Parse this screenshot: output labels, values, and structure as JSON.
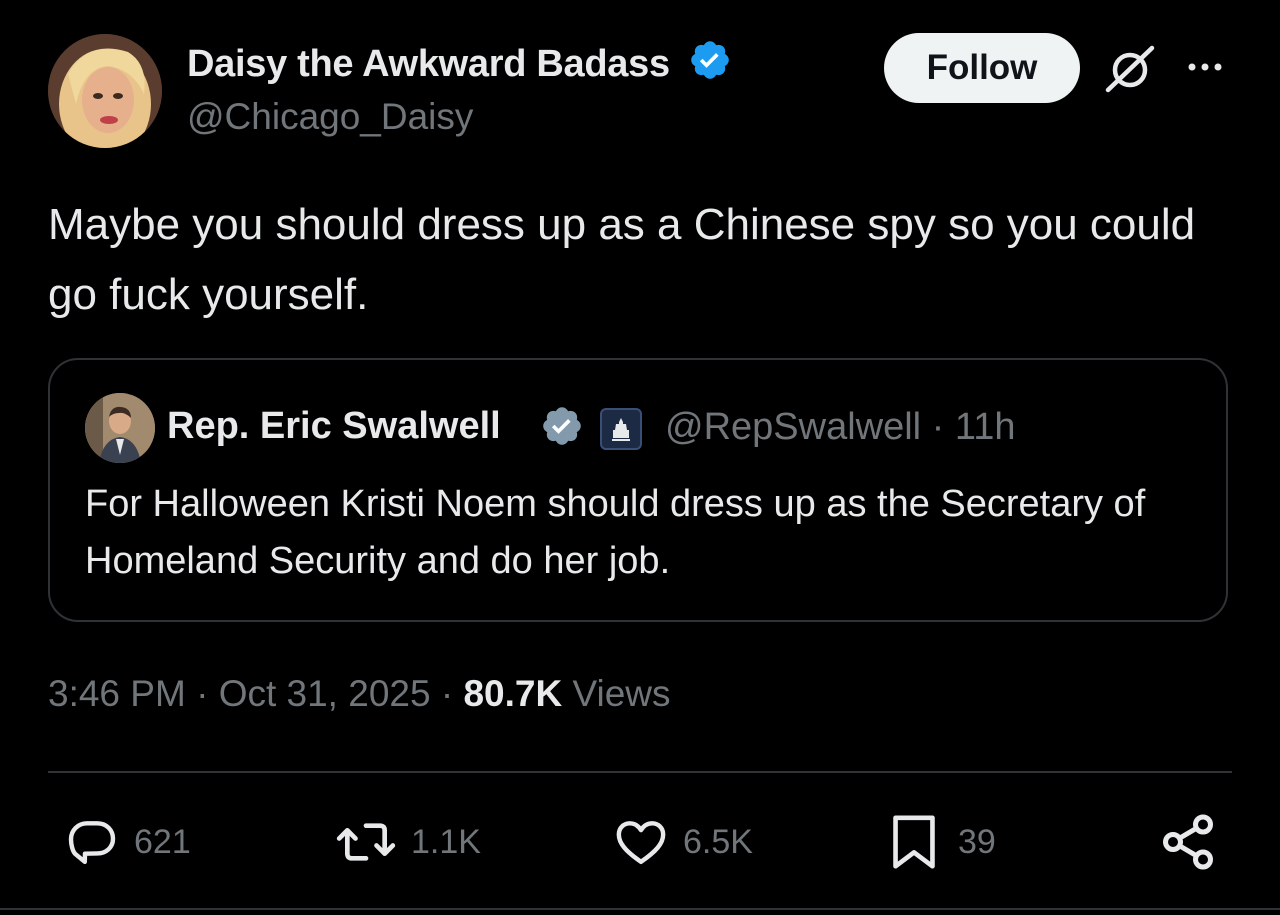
{
  "author": {
    "name": "Daisy the Awkward Badass",
    "handle": "@Chicago_Daisy",
    "verified_color": "#1d9bf0"
  },
  "header": {
    "follow_label": "Follow",
    "icons": [
      "grok-icon",
      "more-icon"
    ]
  },
  "tweet": {
    "text": "Maybe you should dress up as a Chinese spy so you could go fuck yourself."
  },
  "quote": {
    "name": "Rep. Eric Swalwell",
    "handle_time": "@RepSwalwell · 11h",
    "verified_color": "#829aab",
    "text": "For Halloween Kristi Noem should dress up as the Secretary of Homeland Security and do her job."
  },
  "meta": {
    "time": "3:46 PM",
    "date": "Oct 31, 2025",
    "views_count": "80.7K",
    "views_label": "Views",
    "sep": "·"
  },
  "actions": {
    "replies": "621",
    "reposts": "1.1K",
    "likes": "6.5K",
    "bookmarks": "39"
  }
}
